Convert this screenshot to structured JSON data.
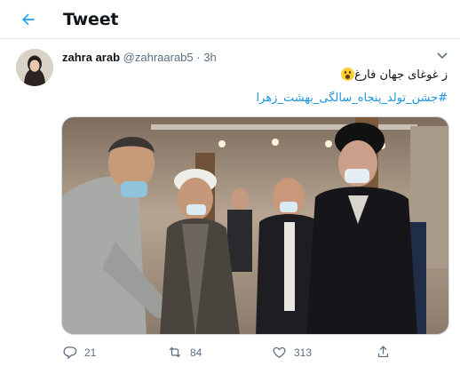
{
  "header": {
    "title": "Tweet"
  },
  "tweet": {
    "author_name": "zahra arab",
    "author_handle": "@zahraarab5",
    "separator": "·",
    "time": "3h",
    "text": "ز غوغای جهان فارغ",
    "hashtag": "#جشن_تولد_پنجاه_سالگی_بهشت_زهرا",
    "emoji": "astonished-face-emoji"
  },
  "actions": {
    "replies": "21",
    "retweets": "84",
    "likes": "313"
  },
  "colors": {
    "accent": "#1da1f2",
    "link": "#1b95e0",
    "muted": "#5b7083",
    "border": "#e6ecf0"
  },
  "icons": {
    "back": "arrow-left-icon",
    "caret": "chevron-down-icon",
    "reply": "reply-icon",
    "retweet": "retweet-icon",
    "like": "heart-icon",
    "share": "share-icon"
  }
}
